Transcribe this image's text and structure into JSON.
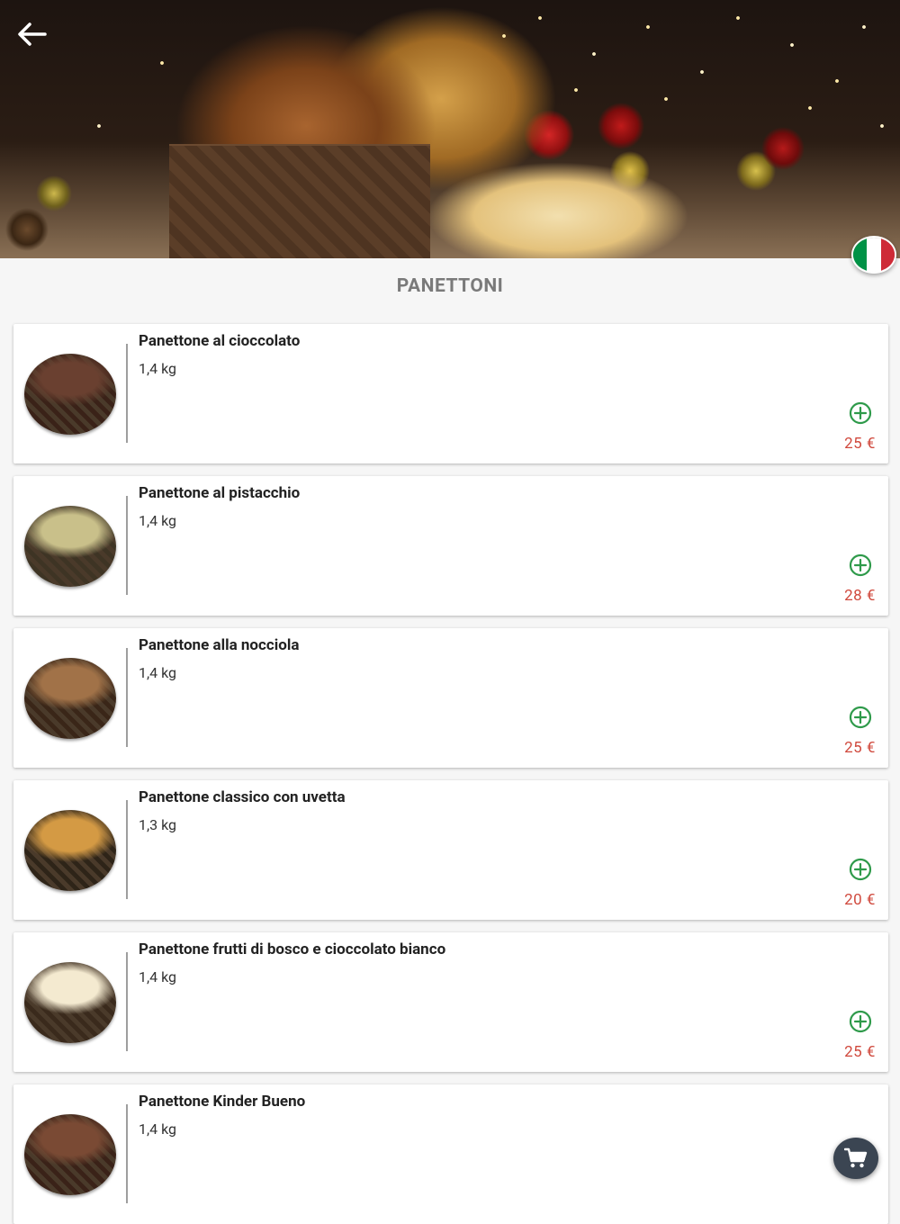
{
  "header": {
    "back_icon": "arrow-left-icon",
    "language_flag": "italian-flag-icon",
    "flag_colors": [
      "#009246",
      "#ffffff",
      "#ce2b37"
    ]
  },
  "section": {
    "title": "PANETTONI"
  },
  "products": [
    {
      "name": "Panettone al cioccolato",
      "weight": "1,4 kg",
      "price": "25 €",
      "add_icon": "plus-circle-icon",
      "thumb_colors": [
        "#6a4030",
        "#3a2218"
      ]
    },
    {
      "name": "Panettone al pistacchio",
      "weight": "1,4 kg",
      "price": "28 €",
      "add_icon": "plus-circle-icon",
      "thumb_colors": [
        "#c9c08a",
        "#3e3424"
      ]
    },
    {
      "name": "Panettone alla nocciola",
      "weight": "1,4 kg",
      "price": "25 €",
      "add_icon": "plus-circle-icon",
      "thumb_colors": [
        "#a17248",
        "#3a2618"
      ]
    },
    {
      "name": "Panettone classico con uvetta",
      "weight": "1,3 kg",
      "price": "20 €",
      "add_icon": "plus-circle-icon",
      "thumb_colors": [
        "#d49a44",
        "#2e2418"
      ]
    },
    {
      "name": "Panettone frutti di bosco e cioccolato bianco",
      "weight": "1,4 kg",
      "price": "25 €",
      "add_icon": "plus-circle-icon",
      "thumb_colors": [
        "#f4ead0",
        "#3a2a1c"
      ]
    },
    {
      "name": "Panettone Kinder Bueno",
      "weight": "1,4 kg",
      "price": "",
      "add_icon": "plus-circle-icon",
      "thumb_colors": [
        "#7a4a34",
        "#3a2218"
      ]
    }
  ],
  "cart": {
    "icon": "shopping-cart-icon"
  },
  "colors": {
    "price": "#d0493d",
    "add_button": "#2e9a4a",
    "fab": "#3b4552",
    "title": "#7a7a7a"
  }
}
